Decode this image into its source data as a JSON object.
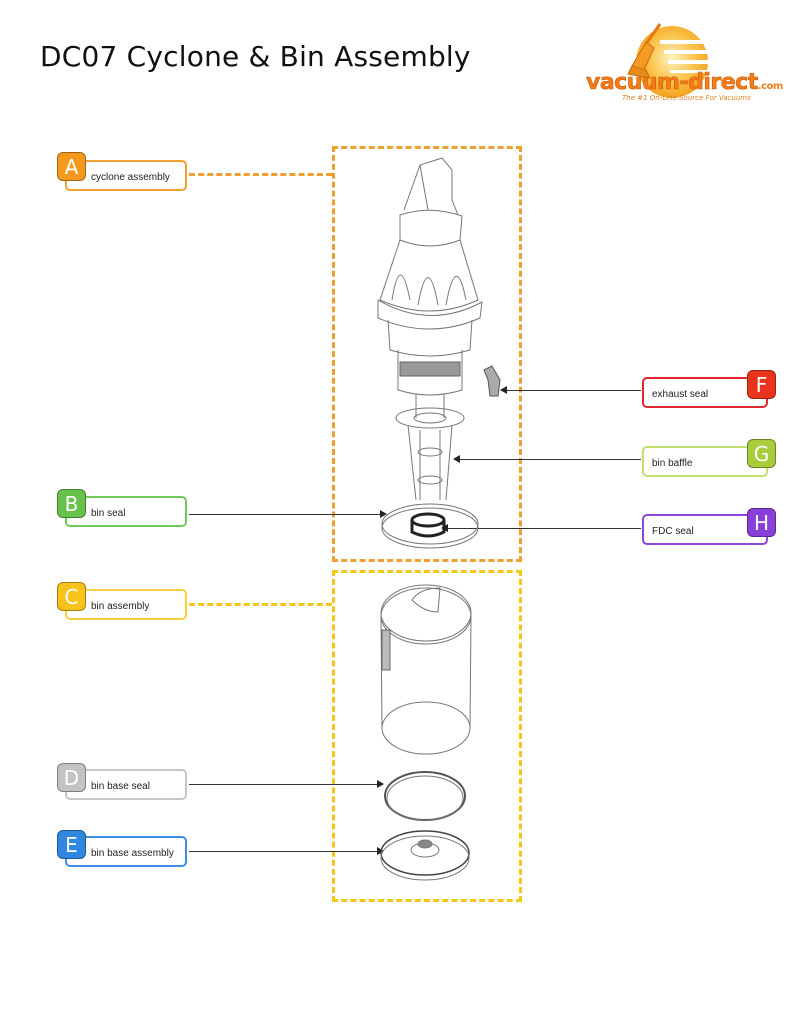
{
  "title": "DC07 Cyclone & Bin Assembly",
  "logo": {
    "brand": "vacuum-direct",
    "suffix": ".com",
    "tagline": "The #1 On-Line Source For Vacuums",
    "icon": "upright-vacuum-icon"
  },
  "colors": {
    "group_upper": "#f0a030",
    "group_lower": "#f5c518"
  },
  "parts": [
    {
      "letter": "A",
      "name": "cyclone assembly",
      "color": "#f39a1e",
      "border": "#f0a030",
      "side": "left"
    },
    {
      "letter": "B",
      "name": "bin seal",
      "color": "#66c24a",
      "border": "#6ec958",
      "side": "left"
    },
    {
      "letter": "C",
      "name": "bin assembly",
      "color": "#f7c21a",
      "border": "#f5cf40",
      "side": "left"
    },
    {
      "letter": "D",
      "name": "bin base seal",
      "color": "#c3c3c3",
      "border": "#c6c6c6",
      "side": "left"
    },
    {
      "letter": "E",
      "name": "bin base assembly",
      "color": "#2f87e0",
      "border": "#3b8ee4",
      "side": "left"
    },
    {
      "letter": "F",
      "name": "exhaust seal",
      "color": "#e8341c",
      "border": "#e0262f",
      "side": "right"
    },
    {
      "letter": "G",
      "name": "bin baffle",
      "color": "#a8cc3a",
      "border": "#c2e070",
      "side": "right"
    },
    {
      "letter": "H",
      "name": "FDC seal",
      "color": "#8a3fd8",
      "border": "#8c44dc",
      "side": "right"
    }
  ]
}
